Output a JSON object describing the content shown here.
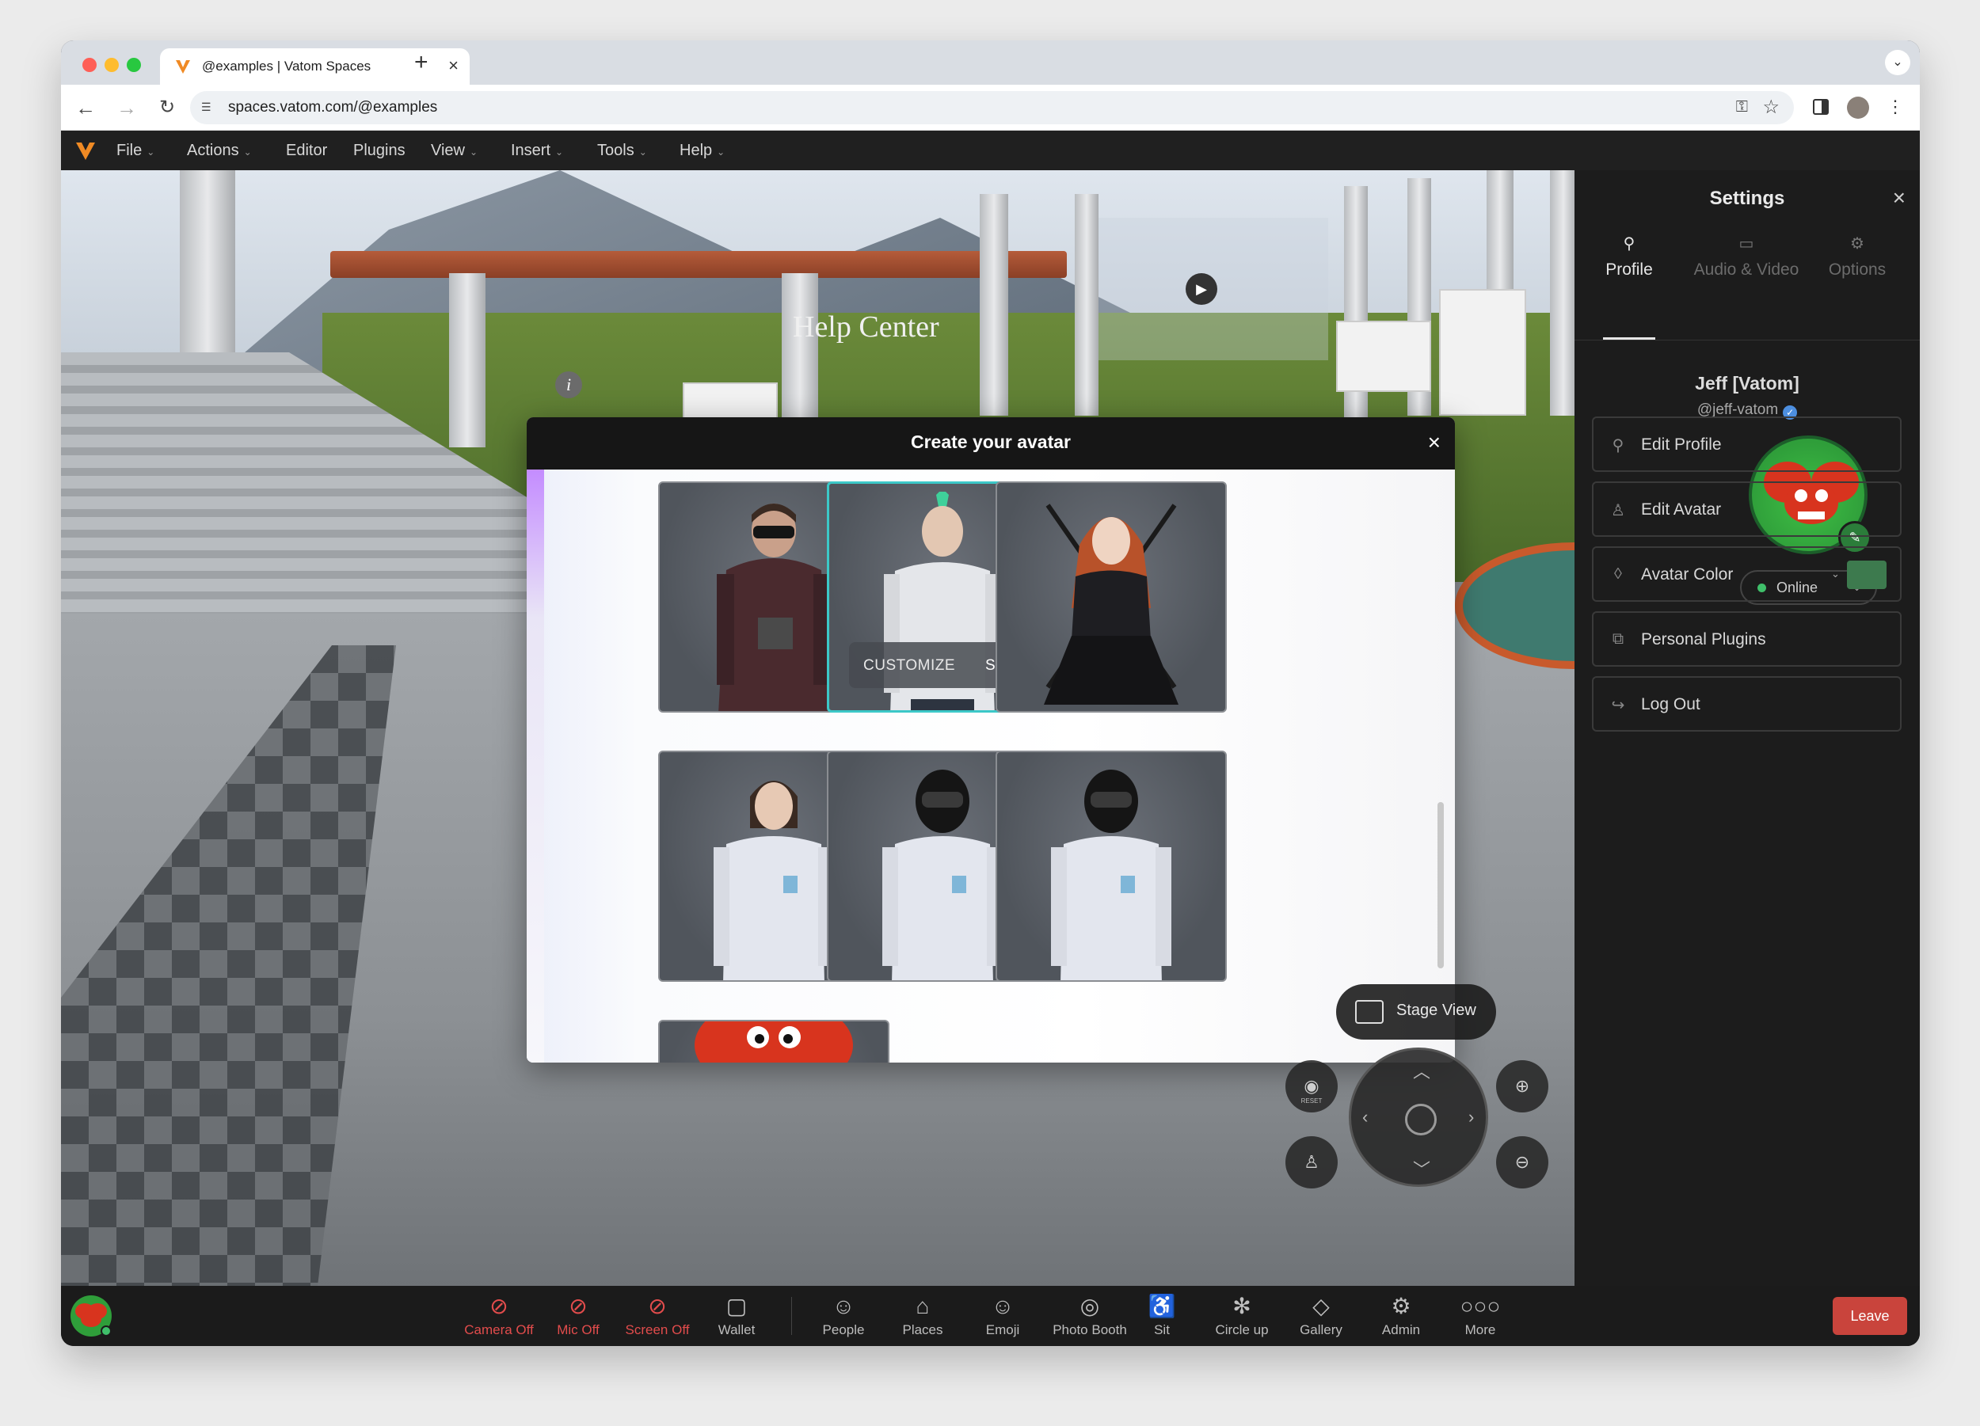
{
  "browser": {
    "tab_title": "@examples | Vatom Spaces",
    "url": "spaces.vatom.com/@examples",
    "new_tab_icon": "plus-icon"
  },
  "app_menu": {
    "items": [
      {
        "label": "File",
        "has_caret": true
      },
      {
        "label": "Actions",
        "has_caret": true
      },
      {
        "label": "Editor",
        "has_caret": false
      },
      {
        "label": "Plugins",
        "has_caret": false
      },
      {
        "label": "View",
        "has_caret": true
      },
      {
        "label": "Insert",
        "has_caret": true
      },
      {
        "label": "Tools",
        "has_caret": true
      },
      {
        "label": "Help",
        "has_caret": true
      }
    ],
    "logo_color": "#f08a24"
  },
  "scene": {
    "sign_text": "Help Center"
  },
  "modal": {
    "title": "Create your avatar",
    "customize_label": "CUSTOMIZE",
    "select_label": "SELECT",
    "selected_index": 1,
    "avatars": [
      {
        "name": "Goggles adventurer"
      },
      {
        "name": "Mohawk man"
      },
      {
        "name": "Red-haired woman"
      },
      {
        "name": "Woman in white jumpsuit"
      },
      {
        "name": "Helmet racer"
      },
      {
        "name": "Helmet racer 2"
      },
      {
        "name": "Red monster"
      }
    ]
  },
  "settings": {
    "title": "Settings",
    "tabs": [
      {
        "label": "Profile",
        "icon": "person-icon",
        "active": true
      },
      {
        "label": "Audio & Video",
        "icon": "camera-icon",
        "active": false
      },
      {
        "label": "Options",
        "icon": "gear-icon",
        "active": false
      }
    ],
    "user_name": "Jeff [Vatom]",
    "user_handle": "@jeff-vatom",
    "status": "Online",
    "buttons": [
      {
        "label": "Edit Profile",
        "icon": "person-icon"
      },
      {
        "label": "Edit Avatar",
        "icon": "avatar-icon"
      },
      {
        "label": "Avatar Color",
        "icon": "droplet-icon"
      },
      {
        "label": "Personal Plugins",
        "icon": "puzzle-icon"
      },
      {
        "label": "Log Out",
        "icon": "logout-icon"
      }
    ],
    "avatar_color": "#3d7a4e"
  },
  "controls": {
    "stage_view_label": "Stage View",
    "reset_label": "RESET"
  },
  "bottombar": {
    "items": [
      {
        "label": "Camera Off",
        "icon": "camera-off-icon",
        "off": true
      },
      {
        "label": "Mic Off",
        "icon": "mic-off-icon",
        "off": true
      },
      {
        "label": "Screen Off",
        "icon": "screen-off-icon",
        "off": true
      },
      {
        "label": "Wallet",
        "icon": "wallet-icon",
        "off": false
      },
      {
        "label": "People",
        "icon": "people-icon",
        "off": false
      },
      {
        "label": "Places",
        "icon": "places-icon",
        "off": false
      },
      {
        "label": "Emoji",
        "icon": "emoji-icon",
        "off": false
      },
      {
        "label": "Photo Booth",
        "icon": "photo-booth-icon",
        "off": false
      },
      {
        "label": "Sit",
        "icon": "sit-icon",
        "off": false
      },
      {
        "label": "Circle up",
        "icon": "circle-up-icon",
        "off": false
      },
      {
        "label": "Gallery",
        "icon": "gallery-icon",
        "off": false
      },
      {
        "label": "Admin",
        "icon": "admin-icon",
        "off": false
      },
      {
        "label": "More",
        "icon": "more-icon",
        "off": false
      }
    ],
    "leave_label": "Leave"
  }
}
